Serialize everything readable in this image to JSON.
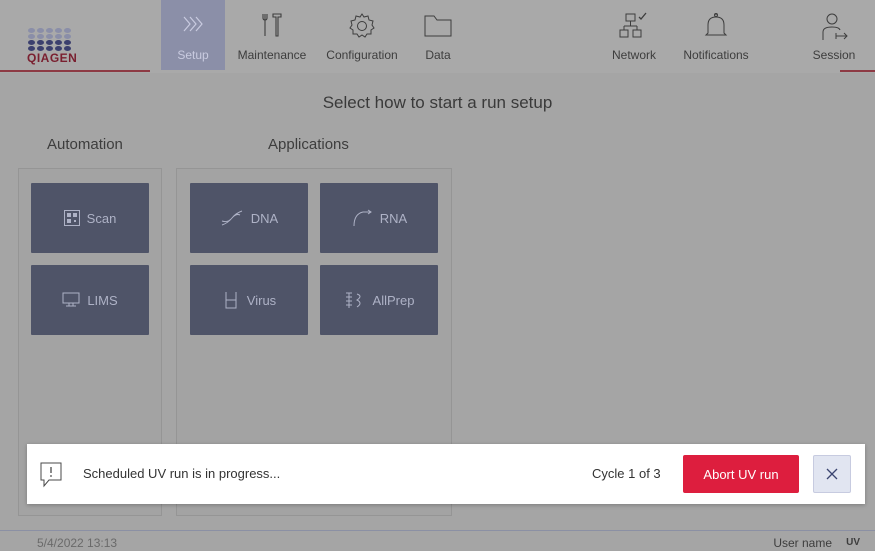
{
  "header": {
    "logo_text": "QIAGEN",
    "nav": {
      "setup": "Setup",
      "maintenance": "Maintenance",
      "configuration": "Configuration",
      "data": "Data",
      "network": "Network",
      "notifications": "Notifications",
      "session": "Session"
    }
  },
  "main": {
    "title": "Select how to start a run setup",
    "automation": {
      "label": "Automation",
      "tiles": [
        "Scan",
        "LIMS"
      ]
    },
    "applications": {
      "label": "Applications",
      "tiles": [
        "DNA",
        "RNA",
        "Virus",
        "AllPrep"
      ]
    }
  },
  "toast": {
    "message": "Scheduled UV run is in progress...",
    "cycle": "Cycle 1 of 3",
    "abort_label": "Abort UV run",
    "icon": "alert-comment-icon",
    "close_icon": "close-icon"
  },
  "footer": {
    "datetime": "5/4/2022 13:13",
    "user_name": "User name",
    "user_initials": "UV"
  },
  "colors": {
    "accent_red": "#dd1e3e",
    "tile": "#4f5468",
    "active_nav": "#8b8fa8"
  }
}
